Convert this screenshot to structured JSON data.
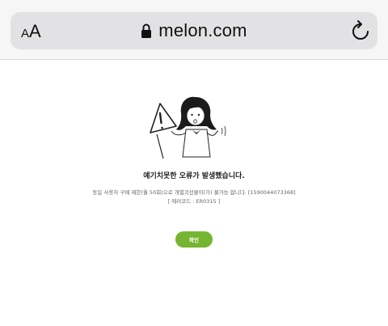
{
  "browser": {
    "text_size_small": "A",
    "text_size_large": "A",
    "url": "melon.com"
  },
  "error": {
    "title": "예기치못한 오류가 발생했습니다.",
    "detail": "동일 사용자 구매 제한(월 50회)으로 개별곡선물이(가) 불가능 합니다. [1590044073368]",
    "code": "[ 에러코드 : ER0315 ]"
  },
  "actions": {
    "confirm_label": "확인"
  },
  "colors": {
    "accent": "#76b531"
  },
  "icons": [
    "lock-icon",
    "reload-icon",
    "warning-sign-icon"
  ]
}
